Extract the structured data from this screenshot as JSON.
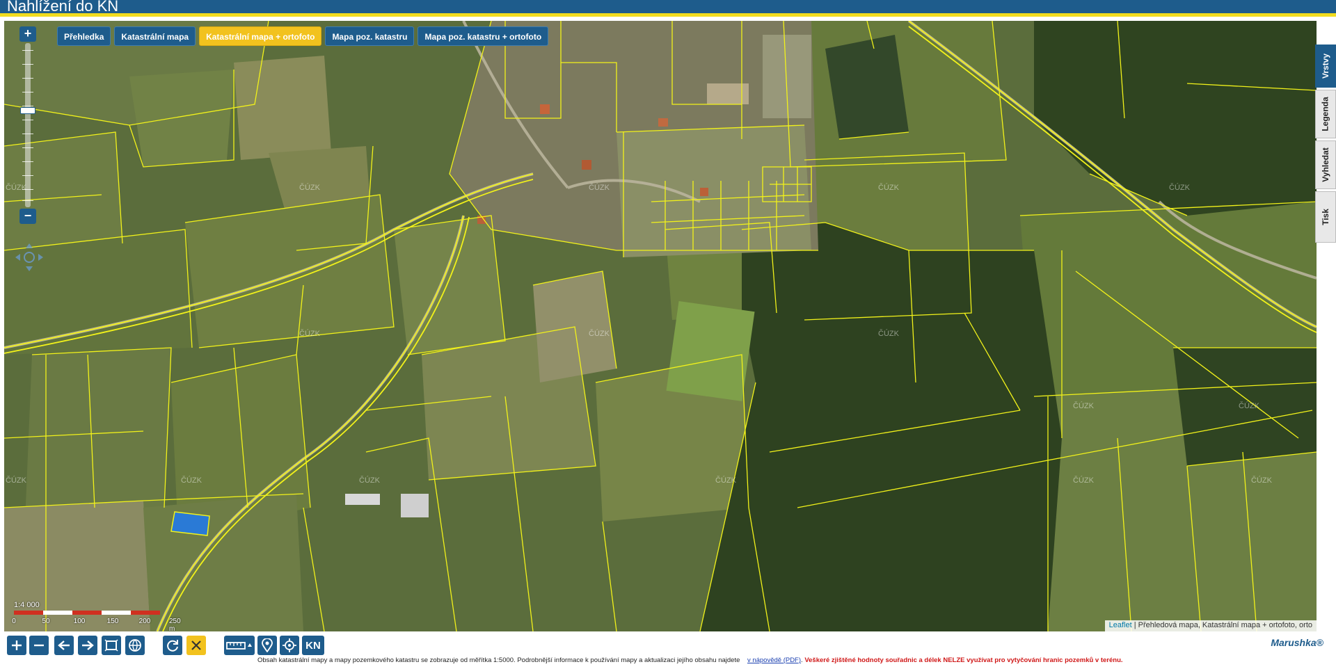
{
  "app": {
    "title": "Nahlížení do KN"
  },
  "map_types": [
    {
      "label": "Přehledka",
      "active": false
    },
    {
      "label": "Katastrální mapa",
      "active": false
    },
    {
      "label": "Katastrální mapa + ortofoto",
      "active": true
    },
    {
      "label": "Mapa poz. katastru",
      "active": false
    },
    {
      "label": "Mapa poz. katastru + ortofoto",
      "active": false
    }
  ],
  "zoom": {
    "in_label": "+",
    "out_label": "−"
  },
  "side_tabs": [
    {
      "label": "Vrstvy",
      "active": true
    },
    {
      "label": "Legenda",
      "active": false
    },
    {
      "label": "Vyhledat",
      "active": false
    },
    {
      "label": "Tisk",
      "active": false
    }
  ],
  "scale": {
    "ratio": "1:4 000",
    "labels": [
      "0",
      "50",
      "100",
      "150",
      "200",
      "250 m"
    ]
  },
  "watermark": "ČÚZK",
  "attribution": {
    "link": "Leaflet",
    "text": "| Přehledová mapa, Katastrální mapa + ortofoto, orto"
  },
  "toolbar": {
    "kn_label": "KN",
    "brand": "Marushka®",
    "icons": [
      "zoom-in-icon",
      "zoom-out-icon",
      "back-arrow-icon",
      "forward-arrow-icon",
      "zoom-rectangle-icon",
      "globe-icon",
      "refresh-icon",
      "clear-icon",
      "measure-icon",
      "location-pin-icon",
      "target-icon"
    ]
  },
  "notice": {
    "text": "Obsah katastrální mapy a mapy pozemkového katastru se zobrazuje od měřítka 1:5000. Podrobnější informace k používání mapy a aktualizaci jejího obsahu najdete",
    "link": "v nápovědě (PDF)",
    "warning": "Veškeré zjištěné hodnoty souřadnic a délek NELZE využívat pro vytyčování hranic pozemků v terénu."
  },
  "colors": {
    "header": "#1e5c8c",
    "accent": "#f2c21e",
    "parcel_lines": "#f2f21a",
    "selected_parcel": "#2a7ad6"
  }
}
